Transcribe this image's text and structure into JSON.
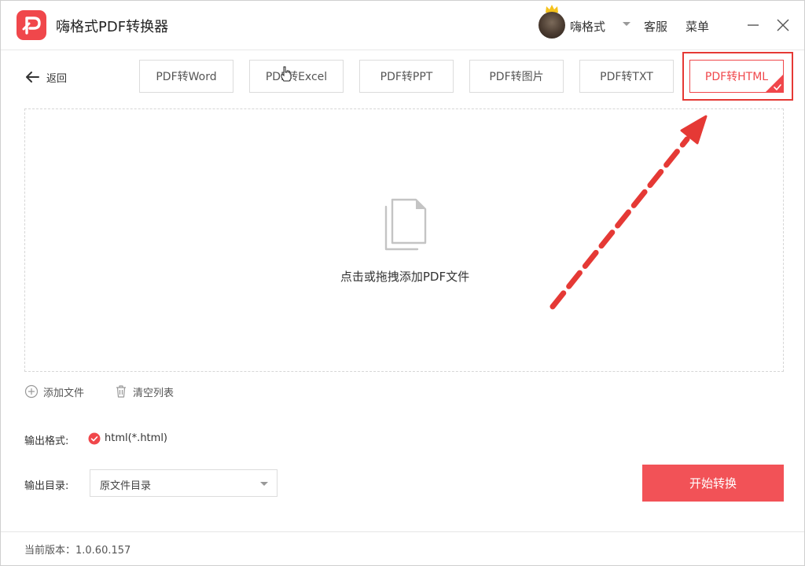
{
  "app": {
    "title": "嗨格式PDF转换器",
    "username": "嗨格式",
    "service_label": "客服",
    "menu_label": "菜单"
  },
  "nav": {
    "back_label": "返回",
    "tabs": [
      {
        "label": "PDF转Word",
        "active": false
      },
      {
        "label": "PDF转Excel",
        "active": false
      },
      {
        "label": "PDF转PPT",
        "active": false
      },
      {
        "label": "PDF转图片",
        "active": false
      },
      {
        "label": "PDF转TXT",
        "active": false
      },
      {
        "label": "PDF转HTML",
        "active": true
      }
    ]
  },
  "dropzone": {
    "hint": "点击或拖拽添加PDF文件"
  },
  "actions": {
    "add_file": "添加文件",
    "clear_list": "清空列表"
  },
  "output": {
    "format_label": "输出格式:",
    "format_value": "html(*.html)",
    "dir_label": "输出目录:",
    "dir_value": "原文件目录"
  },
  "start_button": "开始转换",
  "footer": {
    "version": "当前版本：1.0.60.157"
  },
  "colors": {
    "accent": "#f0474b",
    "button": "#f25257",
    "annotation": "#e53935"
  }
}
